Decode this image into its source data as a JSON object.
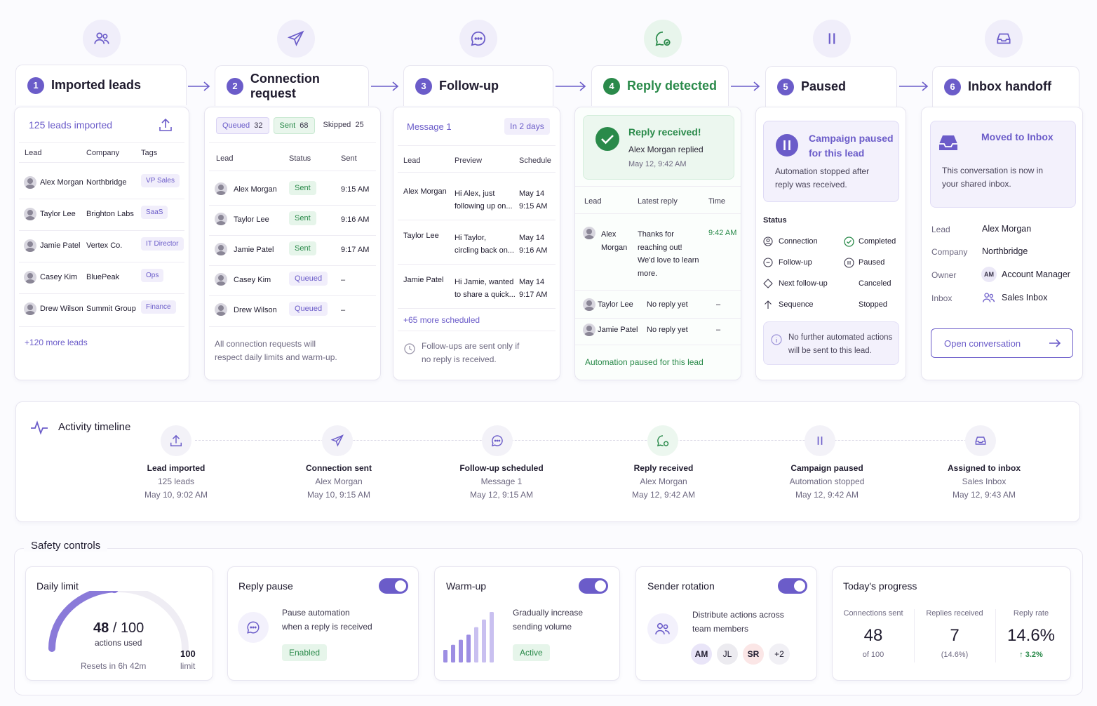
{
  "stages": [
    {
      "num": "1",
      "title": "Imported leads"
    },
    {
      "num": "2",
      "title": "Connection request"
    },
    {
      "num": "3",
      "title": "Follow-up"
    },
    {
      "num": "4",
      "title": "Reply detected"
    },
    {
      "num": "5",
      "title": "Paused"
    },
    {
      "num": "6",
      "title": "Inbox handoff"
    }
  ],
  "imported": {
    "summary": "125 leads imported",
    "headers": [
      "Lead",
      "Company",
      "Tags"
    ],
    "rows": [
      {
        "lead": "Alex Morgan",
        "company": "Northbridge",
        "tag": "VP Sales"
      },
      {
        "lead": "Taylor Lee",
        "company": "Brighton Labs",
        "tag": "SaaS"
      },
      {
        "lead": "Jamie Patel",
        "company": "Vertex Co.",
        "tag": "IT Director"
      },
      {
        "lead": "Casey Kim",
        "company": "BluePeak",
        "tag": "Ops"
      },
      {
        "lead": "Drew Wilson",
        "company": "Summit Group",
        "tag": "Finance"
      }
    ],
    "more": "+120 more leads"
  },
  "connection": {
    "filters": [
      {
        "label": "Queued",
        "count": "32"
      },
      {
        "label": "Sent",
        "count": "68"
      },
      {
        "label": "Skipped",
        "count": "25"
      }
    ],
    "headers": [
      "Lead",
      "Status",
      "Sent"
    ],
    "rows": [
      {
        "lead": "Alex Morgan",
        "status": "Sent",
        "time": "9:15 AM"
      },
      {
        "lead": "Taylor Lee",
        "status": "Sent",
        "time": "9:16 AM"
      },
      {
        "lead": "Jamie Patel",
        "status": "Sent",
        "time": "9:17 AM"
      },
      {
        "lead": "Casey Kim",
        "status": "Queued",
        "time": "–"
      },
      {
        "lead": "Drew Wilson",
        "status": "Queued",
        "time": "–"
      }
    ],
    "note_line1": "All connection requests will",
    "note_line2": "respect daily limits and warm-up."
  },
  "followup": {
    "message": "Message 1",
    "delay": "In 2 days",
    "headers": [
      "Lead",
      "Preview",
      "Schedule"
    ],
    "rows": [
      {
        "lead": "Alex Morgan",
        "preview1": "Hi Alex, just",
        "preview2": "following up on...",
        "date": "May 14",
        "time": "9:15 AM"
      },
      {
        "lead": "Taylor Lee",
        "preview1": "Hi Taylor,",
        "preview2": "circling back on...",
        "date": "May 14",
        "time": "9:16 AM"
      },
      {
        "lead": "Jamie Patel",
        "preview1": "Hi Jamie, wanted",
        "preview2": "to share a quick...",
        "date": "May 14",
        "time": "9:17 AM"
      }
    ],
    "more": "+65 more scheduled",
    "note_line1": "Follow-ups are sent only if",
    "note_line2": "no reply is received."
  },
  "reply": {
    "title": "Reply received!",
    "by": "Alex Morgan replied",
    "when": "May 12, 9:42 AM",
    "headers": [
      "Lead",
      "Latest reply",
      "Time"
    ],
    "main_lead1": "Alex",
    "main_lead2": "Morgan",
    "main_reply": [
      "Thanks for",
      "reaching out!",
      "We'd love to learn",
      "more."
    ],
    "main_time": "9:42 AM",
    "rows": [
      {
        "lead": "Taylor Lee",
        "reply": "No reply yet",
        "time": "–"
      },
      {
        "lead": "Jamie Patel",
        "reply": "No reply yet",
        "time": "–"
      }
    ],
    "footer": "Automation paused for this lead"
  },
  "paused": {
    "title1": "Campaign paused",
    "title2": "for this lead",
    "desc1": "Automation stopped after",
    "desc2": "reply was received.",
    "status_label": "Status",
    "status": [
      {
        "name": "Connection",
        "value": "Completed"
      },
      {
        "name": "Follow-up",
        "value": "Paused"
      },
      {
        "name": "Next follow-up",
        "value": "Canceled"
      },
      {
        "name": "Sequence",
        "value": "Stopped"
      }
    ],
    "info1": "No further automated actions",
    "info2": "will be sent to this lead."
  },
  "inbox": {
    "title": "Moved to Inbox",
    "desc1": "This conversation is now in",
    "desc2": "your shared inbox.",
    "fields": [
      {
        "label": "Lead",
        "value": "Alex Morgan"
      },
      {
        "label": "Company",
        "value": "Northbridge"
      },
      {
        "label": "Owner",
        "value": "Account Manager",
        "badge": "AM"
      },
      {
        "label": "Inbox",
        "value": "Sales Inbox"
      }
    ],
    "button": "Open conversation"
  },
  "timeline": {
    "title": "Activity timeline",
    "events": [
      {
        "title": "Lead imported",
        "sub": "125 leads",
        "time": "May 10, 9:02 AM"
      },
      {
        "title": "Connection sent",
        "sub": "Alex Morgan",
        "time": "May 10, 9:15 AM"
      },
      {
        "title": "Follow-up scheduled",
        "sub": "Message 1",
        "time": "May 12, 9:15 AM"
      },
      {
        "title": "Reply received",
        "sub": "Alex Morgan",
        "time": "May 12, 9:42 AM"
      },
      {
        "title": "Campaign paused",
        "sub": "Automation stopped",
        "time": "May 12, 9:42 AM"
      },
      {
        "title": "Assigned to inbox",
        "sub": "Sales Inbox",
        "time": "May 12, 9:43 AM"
      }
    ]
  },
  "safety": {
    "title": "Safety controls",
    "daily": {
      "title": "Daily limit",
      "used": "48",
      "sep": "/",
      "limit": "100",
      "unit": "actions used",
      "reset": "Resets in 6h 42m",
      "limit_label_num": "100",
      "limit_label": "limit",
      "fraction": 0.48
    },
    "reply_pause": {
      "title": "Reply pause",
      "desc1": "Pause automation",
      "desc2": "when a reply is received",
      "status": "Enabled"
    },
    "warmup": {
      "title": "Warm-up",
      "desc1": "Gradually increase",
      "desc2": "sending volume",
      "status": "Active",
      "bars": [
        0.25,
        0.35,
        0.45,
        0.55,
        0.7,
        0.85,
        1.0
      ]
    },
    "rotation": {
      "title": "Sender rotation",
      "desc1": "Distribute actions across",
      "desc2": "team members",
      "members": [
        "AM",
        "JL",
        "SR",
        "+2"
      ]
    },
    "progress": {
      "title": "Today's progress",
      "stats": [
        {
          "label": "Connections sent",
          "value": "48",
          "sub": "of 100"
        },
        {
          "label": "Replies received",
          "value": "7",
          "sub": "(14.6%)"
        },
        {
          "label": "Reply rate",
          "value": "14.6%",
          "sub": "↑ 3.2%"
        }
      ]
    }
  },
  "colors": {
    "accent": "#6b5cc9",
    "success": "#2a8a4a"
  }
}
